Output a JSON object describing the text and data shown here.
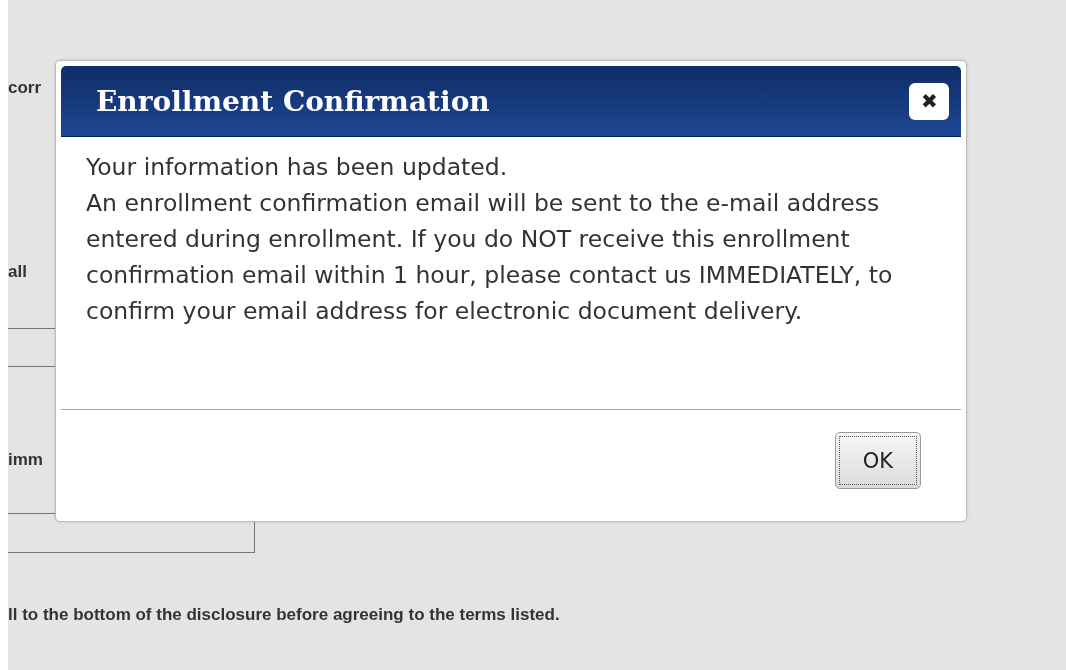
{
  "background": {
    "fragments": [
      "corr",
      "all",
      "imm"
    ],
    "notice": "ll to the bottom of the disclosure before agreeing to the terms listed."
  },
  "dialog": {
    "title": "Enrollment Confirmation",
    "close": "✖",
    "message_lines": [
      "Your information has been updated.",
      "An enrollment confirmation email will be sent to the e-mail address",
      "entered during enrollment. If you do NOT receive this enrollment",
      "confirmation email within 1 hour, please contact us IMMEDIATELY, to",
      "confirm your email address for electronic document delivery."
    ],
    "buttons": [
      "OK"
    ]
  }
}
